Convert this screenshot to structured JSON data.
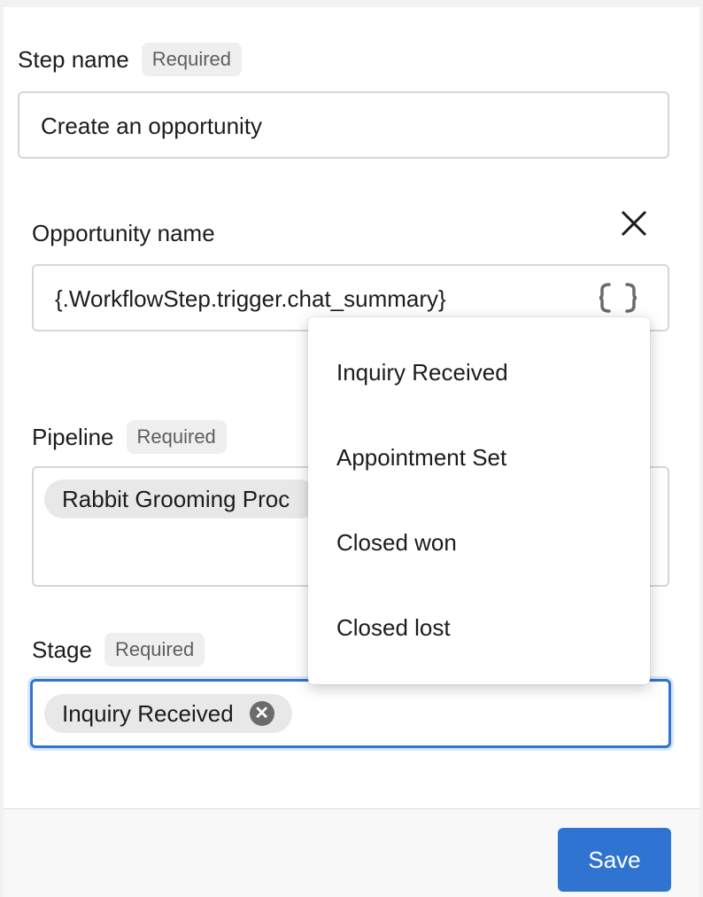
{
  "step_name": {
    "label": "Step name",
    "required": "Required",
    "value": "Create an opportunity"
  },
  "opportunity_name": {
    "label": "Opportunity name",
    "close_icon": "close-icon",
    "value": "{.WorkflowStep.trigger.chat_summary}",
    "variable_icon": "braces-icon"
  },
  "pipeline": {
    "label": "Pipeline",
    "required": "Required",
    "chip": "Rabbit Grooming Proc"
  },
  "stage": {
    "label": "Stage",
    "required": "Required",
    "chip": "Inquiry Received"
  },
  "dropdown": {
    "options": [
      "Inquiry Received",
      "Appointment Set",
      "Closed won",
      "Closed lost"
    ]
  },
  "footer": {
    "save_label": "Save"
  },
  "colors": {
    "accent": "#2f74d0",
    "focus_border": "#2f74d0",
    "badge_bg": "#efefef"
  }
}
